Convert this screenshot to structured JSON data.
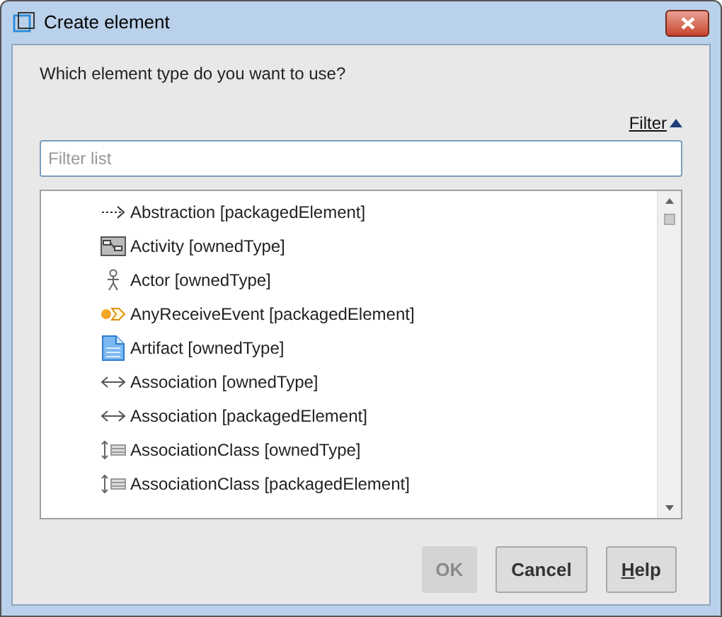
{
  "window": {
    "title": "Create element"
  },
  "prompt": "Which element type do you want to use?",
  "filter_toggle": {
    "label": "Filter",
    "expanded": true
  },
  "filter_field": {
    "placeholder": "Filter list"
  },
  "items": [
    {
      "label": "Abstraction [packagedElement]",
      "kind": "dependency"
    },
    {
      "label": "Activity [ownedType]",
      "kind": "activity"
    },
    {
      "label": "Actor [ownedType]",
      "kind": "actor"
    },
    {
      "label": "AnyReceiveEvent [packagedElement]",
      "kind": "event"
    },
    {
      "label": "Artifact [ownedType]",
      "kind": "artifact"
    },
    {
      "label": "Association [ownedType]",
      "kind": "association"
    },
    {
      "label": "Association [packagedElement]",
      "kind": "association"
    },
    {
      "label": "AssociationClass [ownedType]",
      "kind": "association-class"
    },
    {
      "label": "AssociationClass [packagedElement]",
      "kind": "association-class"
    }
  ],
  "buttons": [
    {
      "label": "OK",
      "disabled": true,
      "underline_first": false
    },
    {
      "label": "Cancel",
      "disabled": false,
      "underline_first": false
    },
    {
      "label": "Help",
      "disabled": false,
      "underline_first": true
    }
  ]
}
